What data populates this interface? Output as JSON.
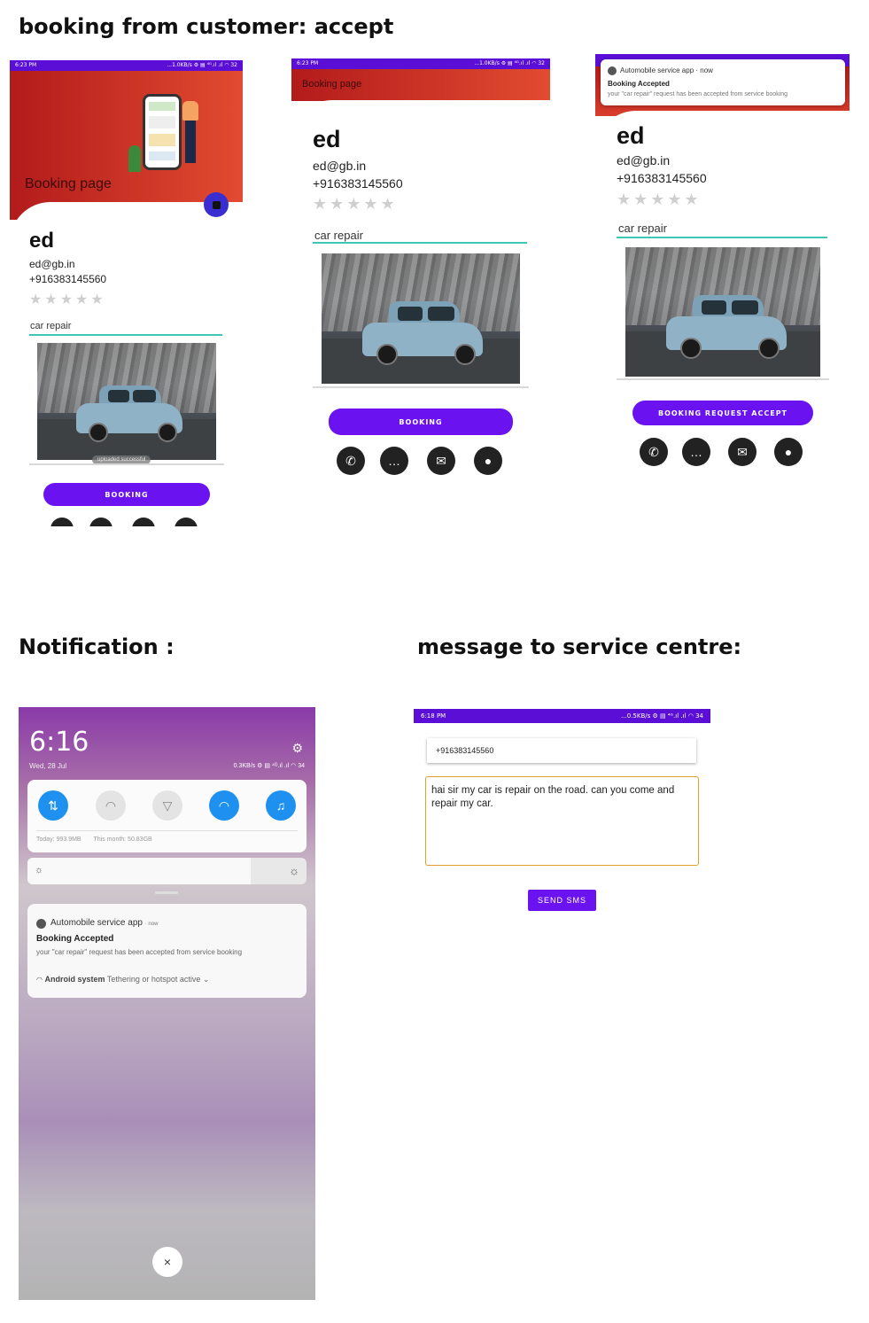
{
  "headings": {
    "top": "booking from customer: accept",
    "notification": "Notification :",
    "message": "message to service centre:"
  },
  "colors": {
    "primary": "#6a12f0",
    "status_bar": "#5b0fd6",
    "header_red": "#d6372a",
    "teal_underline": "#3cc8b4"
  },
  "screen1": {
    "status_time": "6:23 PM",
    "status_right": "...1.0KB/s ⚙ ▤ ⁴ᴳ.ıl .ıl ◠ 32",
    "title": "Booking page",
    "name": "ed",
    "email": "ed@gb.in",
    "phone": "+916383145560",
    "stars": "★★★★★",
    "service": "car repair",
    "toast": "uploaded successful",
    "button": "BOOKING",
    "fab_icon": "bag-icon"
  },
  "screen2": {
    "status_time": "6:23 PM",
    "status_right": "...1.0KB/s ⚙ ▤ ⁴ᴳ.ıl .ıl ◠ 32",
    "title": "Booking page",
    "name": "ed",
    "email": "ed@gb.in",
    "phone": "+916383145560",
    "stars": "★★★★★",
    "service": "car repair",
    "button": "BOOKING",
    "icons": [
      "phone-icon",
      "chat-icon",
      "mail-icon",
      "location-icon"
    ]
  },
  "screen3": {
    "notif_app": "Automobile service app · now",
    "notif_title": "Booking Accepted",
    "notif_body": "your \"car repair\" request has been accepted from service booking",
    "name": "ed",
    "email": "ed@gb.in",
    "phone": "+916383145560",
    "stars": "★★★★★",
    "service": "car repair",
    "button": "BOOKING REQUEST ACCEPT",
    "icons": [
      "phone-icon",
      "chat-icon",
      "mail-icon",
      "location-icon"
    ]
  },
  "shade": {
    "time": "6:16",
    "date": "Wed, 28 Jul",
    "status_right": "0.3KB/s ⚙ ▤ ⁴ᴳ.ıl .ıl ◠ 34",
    "data_usage_today": "Today: 993.9MB",
    "data_usage_month": "This month: 50.83GB",
    "brightness_fraction": 0.8,
    "notif_app": "Automobile service app",
    "notif_time": "· now",
    "notif_title": "Booking Accepted",
    "notif_body": "your \"car repair\" request has been accepted from service booking",
    "system_bold": "Android system",
    "system_text": "Tethering or hotspot active ⌄",
    "close": "×"
  },
  "sms": {
    "status_time": "6:18 PM",
    "status_right": "...0.5KB/s ⚙ ▤ ⁴ᴳ.ıl .ıl ◠ 34",
    "phone": "+916383145560",
    "message": "hai sir my car is repair on the road. can you come and repair my car.",
    "button": "SEND SMS"
  }
}
